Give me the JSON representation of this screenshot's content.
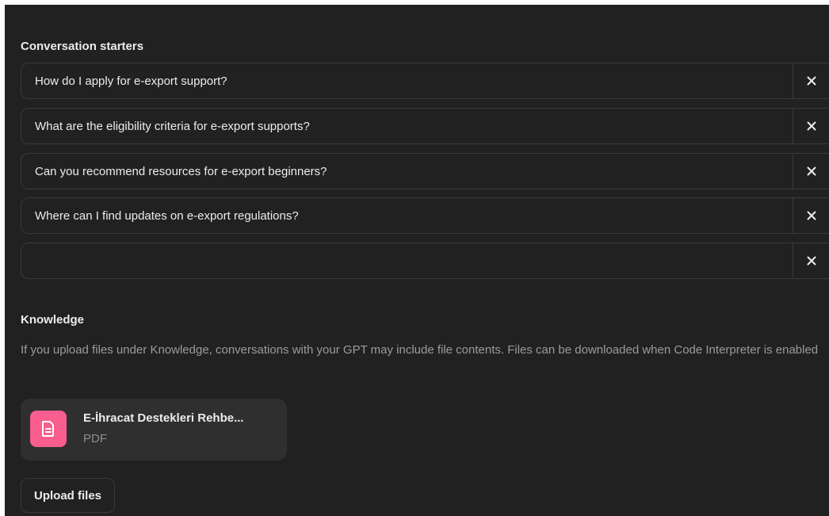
{
  "conversation_starters": {
    "title": "Conversation starters",
    "items": [
      {
        "value": "How do I apply for e-export support?",
        "placeholder": ""
      },
      {
        "value": "What are the eligibility criteria for e-export supports?",
        "placeholder": ""
      },
      {
        "value": "Can you recommend resources for e-export beginners?",
        "placeholder": ""
      },
      {
        "value": "Where can I find updates on e-export regulations?",
        "placeholder": ""
      },
      {
        "value": "",
        "placeholder": ""
      }
    ],
    "remove_icon": "close-icon"
  },
  "knowledge": {
    "title": "Knowledge",
    "description": "If you upload files under Knowledge, conversations with your GPT may include file contents. Files can be downloaded when Code Interpreter is enabled",
    "files": [
      {
        "name": "E-İhracat Destekleri Rehbe...",
        "type": "PDF",
        "icon": "document-icon"
      }
    ],
    "upload_label": "Upload files"
  },
  "colors": {
    "background": "#212121",
    "text": "#ececec",
    "muted_text": "#9b9b9b",
    "border": "#3a3a3a",
    "file_card": "#2f2f2f",
    "file_icon_accent": "#fa5d8f"
  }
}
